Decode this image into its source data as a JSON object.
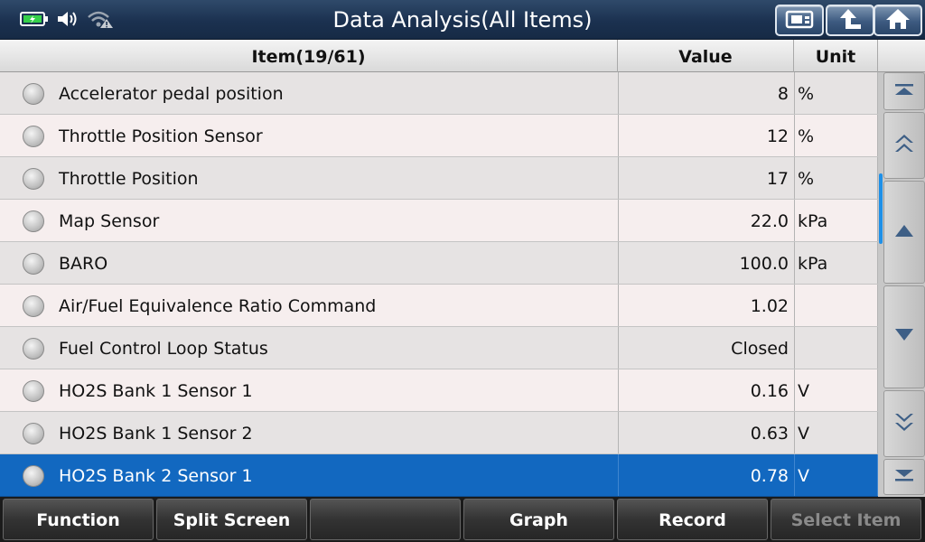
{
  "header": {
    "title": "Data Analysis(All Items)",
    "status_icons": [
      "battery-charging-icon",
      "speaker-icon",
      "wifi-warning-icon"
    ],
    "buttons": [
      "screenshot-icon",
      "back-icon",
      "home-icon"
    ]
  },
  "table": {
    "columns": {
      "item": "Item(19/61)",
      "value": "Value",
      "unit": "Unit"
    },
    "rows": [
      {
        "name": "Accelerator pedal position",
        "value": "8",
        "unit": "%"
      },
      {
        "name": "Throttle Position Sensor",
        "value": "12",
        "unit": "%"
      },
      {
        "name": "Throttle Position",
        "value": "17",
        "unit": "%"
      },
      {
        "name": "Map Sensor",
        "value": "22.0",
        "unit": "kPa"
      },
      {
        "name": "BARO",
        "value": "100.0",
        "unit": "kPa"
      },
      {
        "name": "Air/Fuel Equivalence Ratio Command",
        "value": "1.02",
        "unit": ""
      },
      {
        "name": "Fuel Control Loop Status",
        "value": "Closed",
        "unit": ""
      },
      {
        "name": "HO2S Bank 1 Sensor 1",
        "value": "0.16",
        "unit": "V"
      },
      {
        "name": "HO2S Bank 1 Sensor 2",
        "value": "0.63",
        "unit": "V"
      },
      {
        "name": "HO2S Bank 2 Sensor 1",
        "value": "0.78",
        "unit": "V"
      }
    ],
    "selected_row": 9
  },
  "colors": {
    "selected": "#1268c0",
    "title_bar": "#1b3150",
    "scroll_indicator": "#1e90e8"
  },
  "toolbar": {
    "function": "Function",
    "split_screen": "Split Screen",
    "blank": "",
    "graph": "Graph",
    "record": "Record",
    "select_item": "Select Item"
  }
}
